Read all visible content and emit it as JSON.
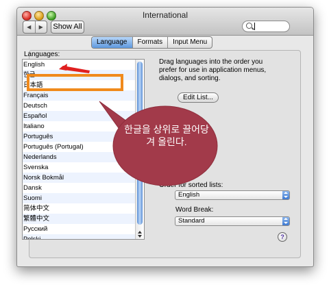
{
  "window": {
    "title": "International"
  },
  "toolbar": {
    "back": "◀",
    "forward": "▶",
    "show_all": "Show All",
    "search_placeholder": ""
  },
  "tabs": [
    "Language",
    "Formats",
    "Input Menu"
  ],
  "languages_label": "Languages:",
  "languages": [
    "English",
    "한글",
    "日本語",
    "Français",
    "Deutsch",
    "Español",
    "Italiano",
    "Português",
    "Português (Portugal)",
    "Nederlands",
    "Svenska",
    "Norsk Bokmål",
    "Dansk",
    "Suomi",
    "简体中文",
    "繁體中文",
    "Русский",
    "Polski"
  ],
  "description": "Drag languages into the order you prefer for use in application menus, dialogs, and sorting.",
  "edit_list": "Edit List...",
  "sort_label": "Order for sorted lists:",
  "sort_value": "English",
  "word_break_label": "Word Break:",
  "word_break_value": "Standard",
  "help": "?",
  "annotation": {
    "text": "한글을 상위로 끌어당겨 올린다."
  },
  "colors": {
    "highlight": "#f08a1c",
    "arrow": "#e02020",
    "bubble": "#a23a4a",
    "tab_active": "#6ea3e4"
  }
}
